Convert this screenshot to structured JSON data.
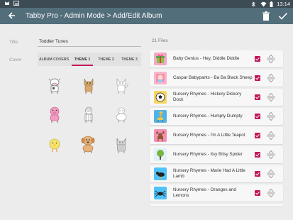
{
  "status_bar": {
    "left_icons": [
      "cat-icon",
      "image-icon"
    ],
    "time": "13:14",
    "right_icons": [
      "bluetooth-icon",
      "wifi-icon",
      "battery-icon"
    ]
  },
  "app_bar": {
    "title": "Tabby Pro - Admin Mode > Add/Edit Album",
    "back_icon": "arrow-back-icon",
    "delete_icon": "trash-icon",
    "save_icon": "check-icon"
  },
  "form": {
    "title_label": "Title",
    "title_value": "Toddler Tunes",
    "cover_label": "Cover"
  },
  "cover_tabs": [
    {
      "label": "ALBUM COVERS",
      "active": false
    },
    {
      "label": "THEME 1",
      "active": true
    },
    {
      "label": "THEME 2",
      "active": false
    },
    {
      "label": "THEME 3",
      "active": false
    }
  ],
  "cover_options": [
    "cow-sketch",
    "cat-color",
    "cat-sketch",
    "pig-color",
    "zebra-sketch",
    "sheep-sketch",
    "chick-color",
    "dog-color",
    "cat-gray"
  ],
  "files": {
    "count_label": "21 Files",
    "items": [
      {
        "name": "Baby Genius - Hey, Diddle Diddle",
        "thumb": "gift-icon",
        "checked": true
      },
      {
        "name": "Caspar Babypants - Ba Ba Black Sheep",
        "thumb": "baby-icon",
        "checked": true
      },
      {
        "name": "Nursery Rhymes - Hickory Dickory Dock",
        "thumb": "soccer-ball-icon",
        "checked": true
      },
      {
        "name": "Nursery Rhymes - Humpty Dumpty",
        "thumb": "giraffe-icon",
        "checked": true
      },
      {
        "name": "Nursery Rhymes - I'm A Little Teapot",
        "thumb": "moose-icon",
        "checked": true
      },
      {
        "name": "Nursery Rhymes - Itsy Bitsy Spider",
        "thumb": "tree-icon",
        "checked": true
      },
      {
        "name": "Nursery Rhymes - Marie Had A Little Lamb",
        "thumb": "bird-icon",
        "checked": true
      },
      {
        "name": "Nursery Rhymes - Oranges and Lemons",
        "thumb": "spider-icon",
        "checked": true
      }
    ]
  },
  "colors": {
    "status_bar": "#3d4b54",
    "app_bar": "#536e7b",
    "accent": "#c2185b",
    "background": "#ececec"
  }
}
